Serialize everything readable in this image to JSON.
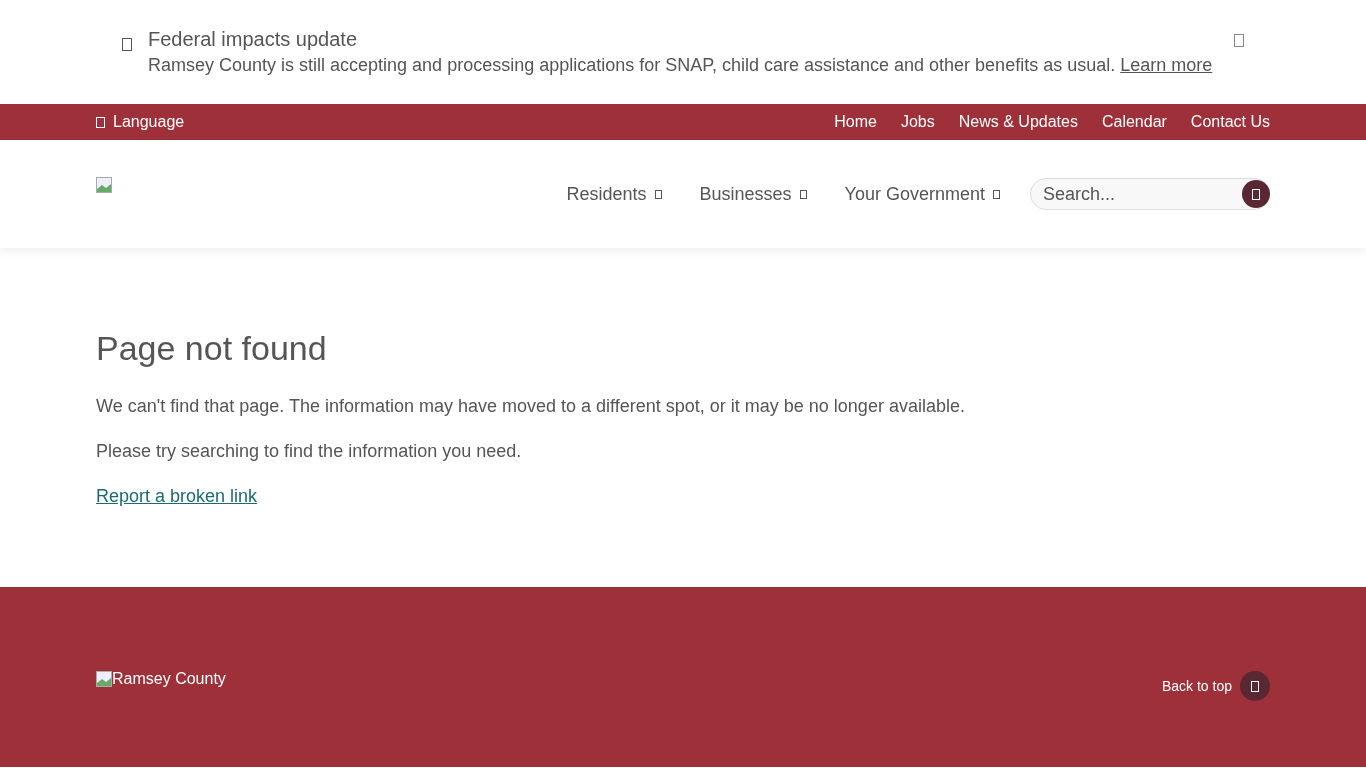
{
  "alert": {
    "title": "Federal impacts update",
    "message": "Ramsey County is still accepting and processing applications for SNAP, child care assistance and other benefits as usual.",
    "link": "Learn more"
  },
  "utility_bar": {
    "language": "Language",
    "links": [
      "Home",
      "Jobs",
      "News & Updates",
      "Calendar",
      "Contact Us"
    ]
  },
  "nav": {
    "items": [
      "Residents",
      "Businesses",
      "Your Government"
    ],
    "search": {
      "placeholder": "Search..."
    }
  },
  "main": {
    "heading": "Page not found",
    "paragraphs": [
      "We can't find that page. The information may have moved to a different spot, or it may be no longer available.",
      "Please try searching to find the information you need."
    ],
    "link": "Report a broken link"
  },
  "footer": {
    "logo_alt": "Ramsey County",
    "back_to_top": "Back to top"
  }
}
